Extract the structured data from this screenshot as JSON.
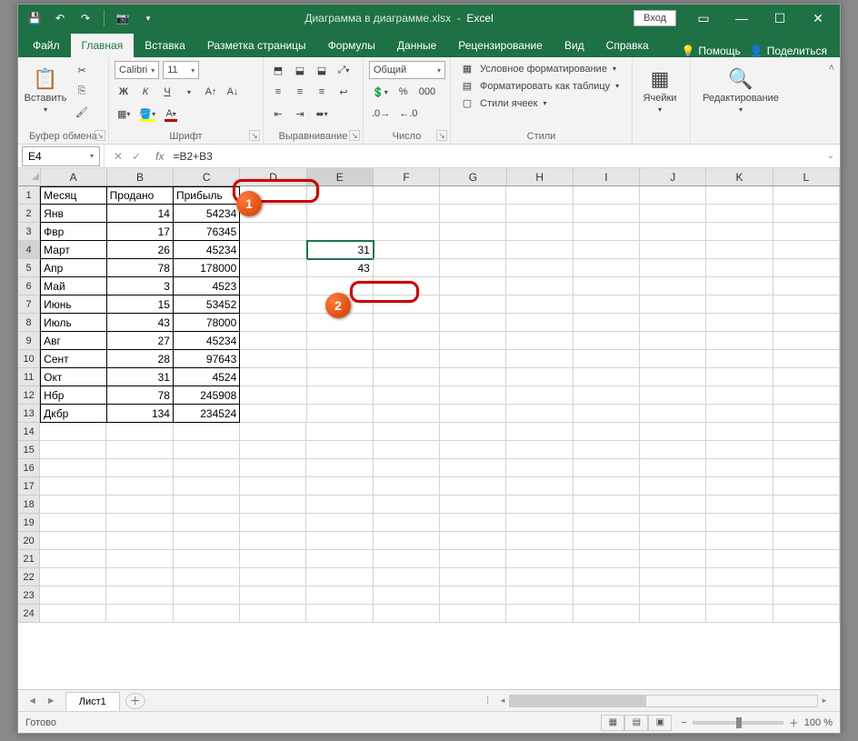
{
  "titlebar": {
    "doc_title": "Диаграмма в диаграмме.xlsx",
    "app_name": "Excel",
    "login": "Вход"
  },
  "tabs": {
    "file": "Файл",
    "home": "Главная",
    "insert": "Вставка",
    "layout": "Разметка страницы",
    "formulas": "Формулы",
    "data": "Данные",
    "review": "Рецензирование",
    "view": "Вид",
    "help": "Справка",
    "tell_me": "Помощь",
    "share": "Поделиться"
  },
  "ribbon": {
    "clipboard": {
      "paste": "Вставить",
      "label": "Буфер обмена"
    },
    "font": {
      "name": "Calibri",
      "size": "11",
      "label": "Шрифт",
      "bold": "Ж",
      "italic": "К",
      "underline": "Ч"
    },
    "align": {
      "label": "Выравнивание"
    },
    "number": {
      "format": "Общий",
      "label": "Число"
    },
    "styles": {
      "cond": "Условное форматирование",
      "table": "Форматировать как таблицу",
      "cell": "Стили ячеек",
      "label": "Стили"
    },
    "cells": {
      "label": "Ячейки"
    },
    "editing": {
      "label": "Редактирование"
    }
  },
  "formula_bar": {
    "cell_ref": "E4",
    "formula": "=B2+B3"
  },
  "columns": [
    "A",
    "B",
    "C",
    "D",
    "E",
    "F",
    "G",
    "H",
    "I",
    "J",
    "K",
    "L"
  ],
  "rows": {
    "headers": {
      "A": "Месяц",
      "B": "Продано",
      "C": "Прибыль"
    },
    "data": [
      {
        "A": "Янв",
        "B": "14",
        "C": "54234"
      },
      {
        "A": "Фвр",
        "B": "17",
        "C": "76345"
      },
      {
        "A": "Март",
        "B": "26",
        "C": "45234",
        "E": "31"
      },
      {
        "A": "Апр",
        "B": "78",
        "C": "178000",
        "E": "43"
      },
      {
        "A": "Май",
        "B": "3",
        "C": "4523"
      },
      {
        "A": "Июнь",
        "B": "15",
        "C": "53452"
      },
      {
        "A": "Июль",
        "B": "43",
        "C": "78000"
      },
      {
        "A": "Авг",
        "B": "27",
        "C": "45234"
      },
      {
        "A": "Сент",
        "B": "28",
        "C": "97643"
      },
      {
        "A": "Окт",
        "B": "31",
        "C": "4524"
      },
      {
        "A": "Нбр",
        "B": "78",
        "C": "245908"
      },
      {
        "A": "Дкбр",
        "B": "134",
        "C": "234524"
      }
    ],
    "blank_count": 11
  },
  "sheet": {
    "name": "Лист1"
  },
  "status": {
    "ready": "Готово",
    "zoom": "100 %"
  },
  "callouts": {
    "n1": "1",
    "n2": "2"
  }
}
